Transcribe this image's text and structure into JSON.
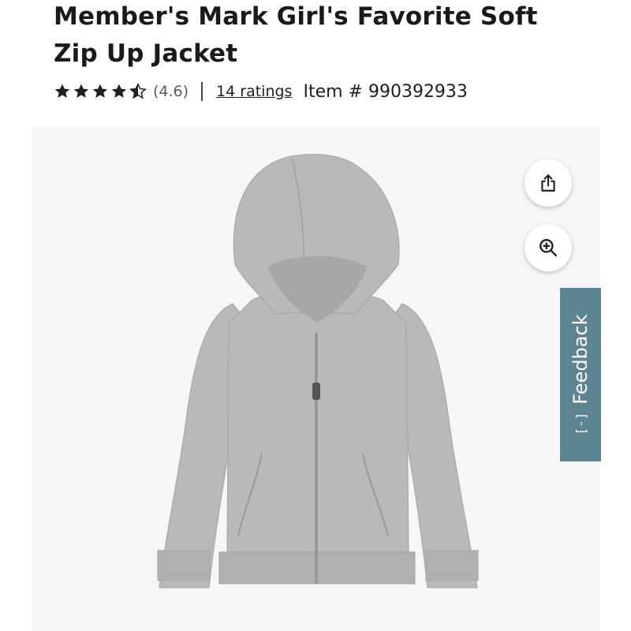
{
  "product": {
    "title": "Member's Mark Girl's Favorite Soft Zip Up Jacket",
    "rating": {
      "value": 4.6,
      "display": "(4.6)",
      "stars_max": 5
    },
    "ratings_link": "14 ratings",
    "item_number": "Item # 990392933"
  },
  "gallery": {
    "image_subject": "gray zip-up hooded jacket",
    "share_icon": "share-icon",
    "zoom_icon": "zoom-in-icon"
  },
  "feedback": {
    "label": "Feedback",
    "icon": "[-]"
  },
  "colors": {
    "title": "#1a1a1a",
    "rating_text": "#5a5a5a",
    "feedback_bg": "#5d8491",
    "jacket": "#b9b9b9",
    "background": "#f6f6f6"
  }
}
